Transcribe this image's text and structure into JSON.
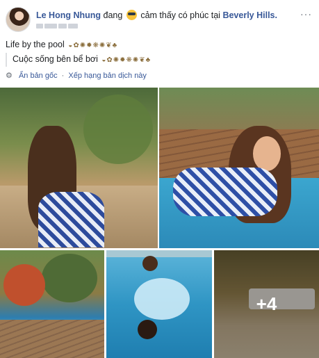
{
  "post": {
    "author": "Le Hong Nhung",
    "verb": "đang",
    "feeling": "cảm thấy có phúc tại",
    "location": "Beverly Hills.",
    "more": "···"
  },
  "content": {
    "original": "Life by the pool",
    "translated": "Cuộc sống bên bể bơi",
    "hide_original": "Ẩn bản gốc",
    "rate_translation": "Xếp hạng bản dịch này",
    "separator": "·"
  },
  "photos": {
    "more_count": "+4"
  }
}
